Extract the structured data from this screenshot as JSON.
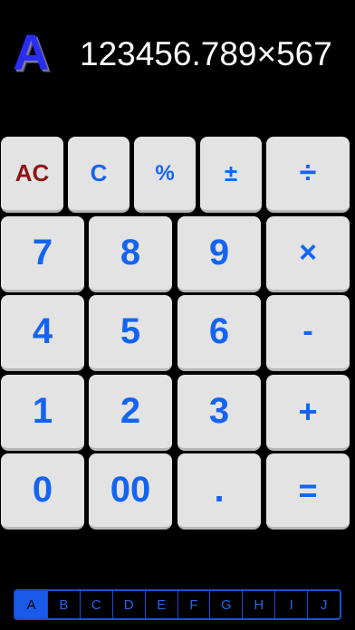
{
  "memory": {
    "letter": "A"
  },
  "display": {
    "text": "123456.789×567"
  },
  "keypad": {
    "ac": "AC",
    "c": "C",
    "percent": "%",
    "plus_minus": "±",
    "divide": "÷",
    "seven": "7",
    "eight": "8",
    "nine": "9",
    "multiply": "×",
    "four": "4",
    "five": "5",
    "six": "6",
    "minus": "-",
    "one": "1",
    "two": "2",
    "three": "3",
    "plus": "+",
    "zero": "0",
    "double_zero": "00",
    "decimal": ".",
    "equals": "="
  },
  "memory_tabs": {
    "items": [
      "A",
      "B",
      "C",
      "D",
      "E",
      "F",
      "G",
      "H",
      "I",
      "J"
    ],
    "selected": "A"
  },
  "colors": {
    "background": "#000000",
    "key_face": "#e3e3e3",
    "key_text": "#1464f0",
    "ac_text": "#8b1616",
    "memory_letter": "#2a2cf0",
    "tab_accent": "#1a5ae8"
  }
}
